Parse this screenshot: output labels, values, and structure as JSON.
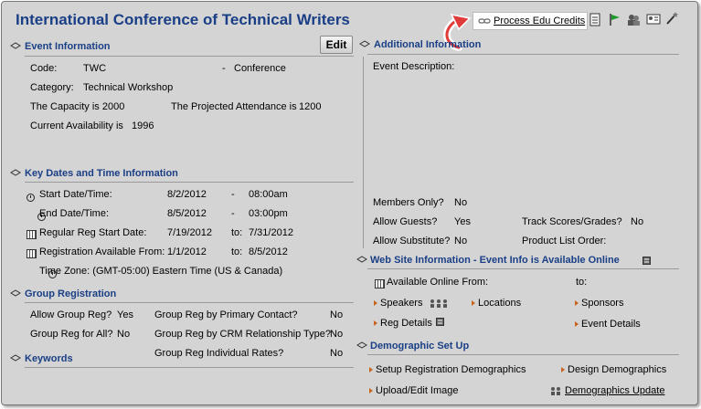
{
  "header": {
    "title": "International Conference of Technical Writers",
    "process_credits": "Process Edu Credits"
  },
  "event_info": {
    "heading": "Event Information",
    "edit_label": "Edit",
    "code_label": "Code:",
    "code_value": "TWC",
    "dash": "-",
    "type_value": "Conference",
    "category_label": "Category:",
    "category_value": "Technical Workshop",
    "capacity_text": "The Capacity is 2000",
    "projected_label": "The Projected Attendance is",
    "projected_value": "1200",
    "availability_label": "Current Availability is",
    "availability_value": "1996"
  },
  "additional_info": {
    "heading": "Additional Information",
    "description_label": "Event Description:",
    "members_only_label": "Members Only?",
    "members_only_value": "No",
    "allow_guests_label": "Allow Guests?",
    "allow_guests_value": "Yes",
    "track_scores_label": "Track Scores/Grades?",
    "track_scores_value": "No",
    "allow_sub_label": "Allow Substitute?",
    "allow_sub_value": "No",
    "product_list_label": "Product List Order:"
  },
  "dates": {
    "heading": "Key Dates and Time Information",
    "start_label": "Start Date/Time:",
    "start_date": "8/2/2012",
    "start_time": "08:00am",
    "end_label": "End Date/Time:",
    "end_date": "8/5/2012",
    "end_time": "03:00pm",
    "reg_label": "Regular Reg Start Date:",
    "reg_start": "7/19/2012",
    "to": "to:",
    "reg_end": "7/31/2012",
    "avail_label": "Registration Available From:",
    "avail_start": "1/1/2012",
    "avail_end": "8/5/2012",
    "timezone": "Time Zone: (GMT-05:00) Eastern Time (US & Canada)"
  },
  "group_reg": {
    "heading": "Group Registration",
    "allow_label": "Allow Group Reg?",
    "allow_value": "Yes",
    "primary_label": "Group Reg by Primary Contact?",
    "primary_value": "No",
    "all_label": "Group Reg for All?",
    "all_value": "No",
    "crm_label": "Group Reg by CRM Relationship Type?",
    "crm_value": "No",
    "rates_label": "Group Reg Individual Rates?",
    "rates_value": "No"
  },
  "keywords": {
    "heading": "Keywords"
  },
  "web_info": {
    "heading": "Web Site Information - Event Info is Available Online",
    "available_label": "Available Online From:",
    "to_label": "to:",
    "speakers": "Speakers",
    "locations": "Locations",
    "sponsors": "Sponsors",
    "reg_details": "Reg Details",
    "event_details": "Event Details"
  },
  "demographic": {
    "heading": "Demographic Set Up",
    "setup_reg": "Setup Registration Demographics",
    "design": "Design Demographics",
    "upload": "Upload/Edit Image",
    "update": "Demographics Update"
  },
  "colors": {
    "heading_blue": "#1a3f86",
    "panel_gray": "#d4d4d4",
    "bullet_orange": "#c8641e",
    "callout_red": "#e03a3a"
  }
}
